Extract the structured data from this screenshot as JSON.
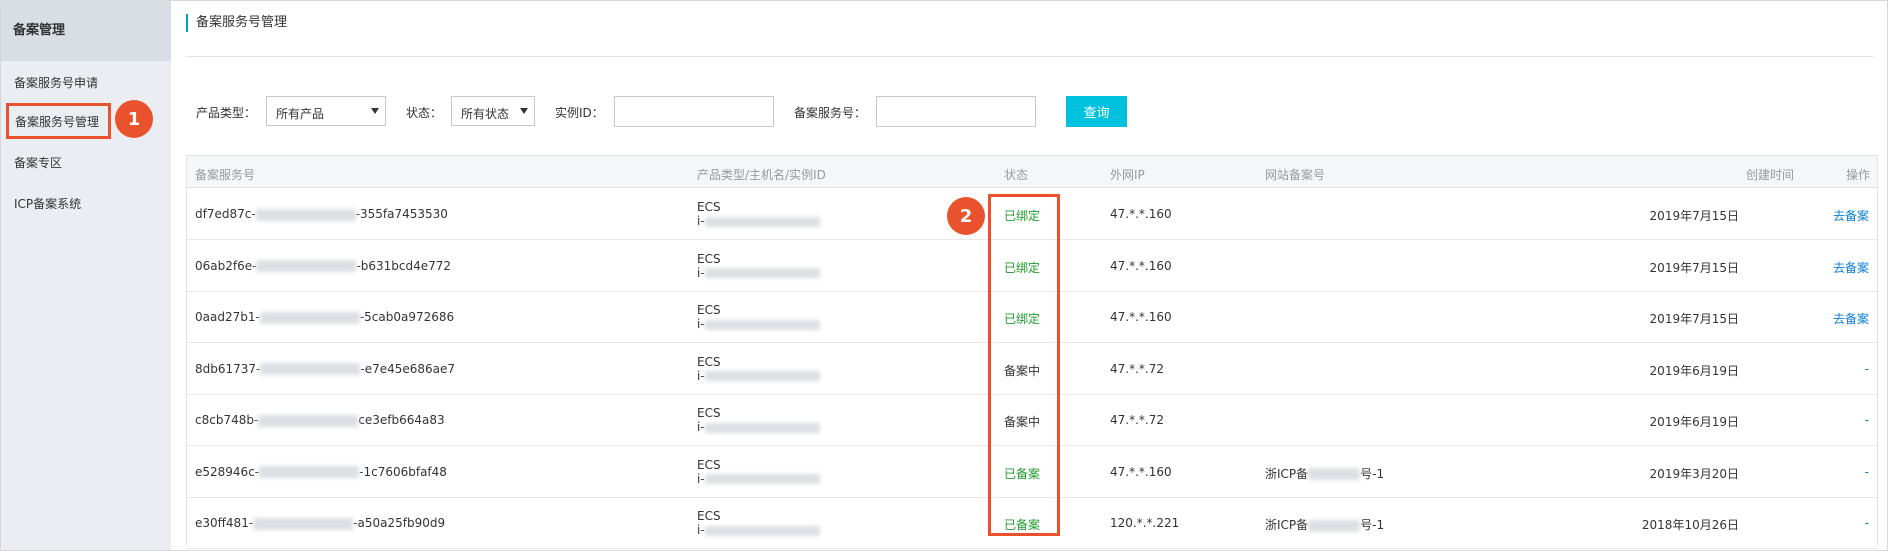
{
  "sidebar": {
    "title": "备案管理",
    "items": [
      {
        "label": "备案服务号申请"
      },
      {
        "label": "备案服务号管理"
      },
      {
        "label": "备案专区"
      },
      {
        "label": "ICP备案系统"
      }
    ]
  },
  "callouts": [
    "1",
    "2"
  ],
  "page": {
    "title": "备案服务号管理"
  },
  "filters": {
    "product_type_label": "产品类型：",
    "product_type_value": "所有产品",
    "status_label": "状态：",
    "status_value": "所有状态",
    "instance_label": "实例ID：",
    "instance_value": "",
    "service_no_label": "备案服务号：",
    "service_no_value": "",
    "query_label": "查询"
  },
  "table": {
    "columns": [
      "备案服务号",
      "产品类型/主机名/实例ID",
      "状态",
      "外网IP",
      "网站备案号",
      "创建时间",
      "操作"
    ],
    "rows": [
      {
        "sn_prefix": "df7ed87c-",
        "sn_suffix": "-355fa7453530",
        "product": "ECS",
        "instance_prefix": "i-",
        "status": "已绑定",
        "status_kind": "ok",
        "ip": "47.*.*.160",
        "icp_prefix": "",
        "icp_suffix": "",
        "created": "2019年7月15日",
        "action": "去备案"
      },
      {
        "sn_prefix": "06ab2f6e-",
        "sn_suffix": "-b631bcd4e772",
        "product": "ECS",
        "instance_prefix": "i-",
        "status": "已绑定",
        "status_kind": "ok",
        "ip": "47.*.*.160",
        "icp_prefix": "",
        "icp_suffix": "",
        "created": "2019年7月15日",
        "action": "去备案"
      },
      {
        "sn_prefix": "0aad27b1-",
        "sn_suffix": "-5cab0a972686",
        "product": "ECS",
        "instance_prefix": "i-",
        "status": "已绑定",
        "status_kind": "ok",
        "ip": "47.*.*.160",
        "icp_prefix": "",
        "icp_suffix": "",
        "created": "2019年7月15日",
        "action": "去备案"
      },
      {
        "sn_prefix": "8db61737-",
        "sn_suffix": "-e7e45e686ae7",
        "product": "ECS",
        "instance_prefix": "i-",
        "status": "备案中",
        "status_kind": "pending",
        "ip": "47.*.*.72",
        "icp_prefix": "",
        "icp_suffix": "",
        "created": "2019年6月19日",
        "action": "-"
      },
      {
        "sn_prefix": "c8cb748b-",
        "sn_suffix": "ce3efb664a83",
        "product": "ECS",
        "instance_prefix": "i-",
        "status": "备案中",
        "status_kind": "pending",
        "ip": "47.*.*.72",
        "icp_prefix": "",
        "icp_suffix": "",
        "created": "2019年6月19日",
        "action": "-"
      },
      {
        "sn_prefix": "e528946c-",
        "sn_suffix": "-1c7606bfaf48",
        "product": "ECS",
        "instance_prefix": "i-",
        "status": "已备案",
        "status_kind": "ok",
        "ip": "47.*.*.160",
        "icp_prefix": "浙ICP备",
        "icp_suffix": "号-1",
        "created": "2019年3月20日",
        "action": "-"
      },
      {
        "sn_prefix": "e30ff481-",
        "sn_suffix": "-a50a25fb90d9",
        "product": "ECS",
        "instance_prefix": "i-",
        "status": "已备案",
        "status_kind": "ok",
        "ip": "120.*.*.221",
        "icp_prefix": "浙ICP备",
        "icp_suffix": "号-1",
        "created": "2018年10月26日",
        "action": "-"
      }
    ]
  }
}
